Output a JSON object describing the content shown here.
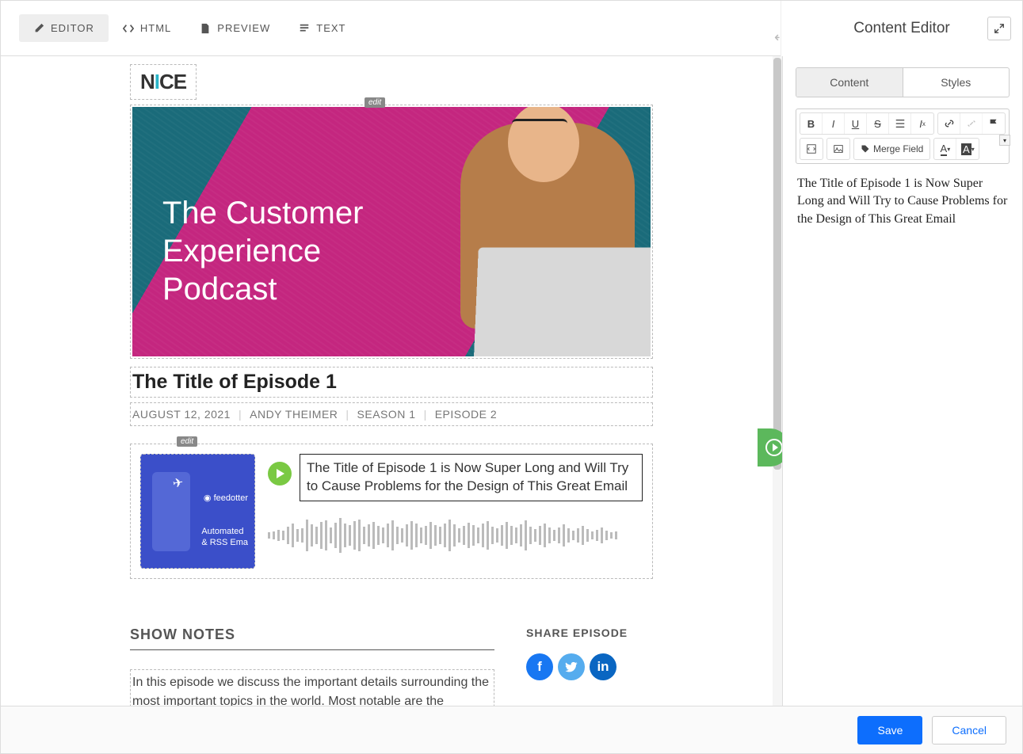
{
  "toolbar": {
    "tabs": {
      "editor": "EDITOR",
      "html": "HTML",
      "preview": "PREVIEW",
      "text": "TEXT"
    }
  },
  "panel": {
    "title": "Content Editor",
    "tabs": {
      "content": "Content",
      "styles": "Styles"
    },
    "mergeField": "Merge Field",
    "editorText": "The Title of Episode 1 is Now Super Long and Will Try to Cause Problems for the Design of This Great Email"
  },
  "email": {
    "logo": {
      "pre": "N",
      "mid": "I",
      "post": "CE"
    },
    "editLabel": "edit",
    "hero": {
      "line1": "The Customer",
      "line2": "Experience",
      "line3": "Podcast"
    },
    "episodeTitle": "The Title of Episode 1",
    "meta": {
      "date": "AUGUST 12, 2021",
      "author": "ANDY THEIMER",
      "season": "SEASON 1",
      "episode": "EPISODE 2"
    },
    "podThumb": {
      "brand": "feedotter",
      "sub1": "Automated",
      "sub2": "& RSS Ema"
    },
    "playerTitle": "The Title of Episode 1 is Now Super Long and Will Try to Cause Problems for the Design of This Great Email",
    "notesHeading": "SHOW NOTES",
    "notesBody": "In this episode we discuss the important details surrounding the most important topics in the world. Most notable are the invention",
    "shareHeading": "SHARE EPISODE",
    "social": {
      "fb": "f",
      "tw": "t",
      "li": "in"
    }
  },
  "buttons": {
    "save": "Save",
    "cancel": "Cancel"
  },
  "toolLabels": {
    "bold": "B",
    "italic": "I",
    "underline": "U",
    "strike": "S",
    "fontA1": "A",
    "fontA2": "A"
  }
}
